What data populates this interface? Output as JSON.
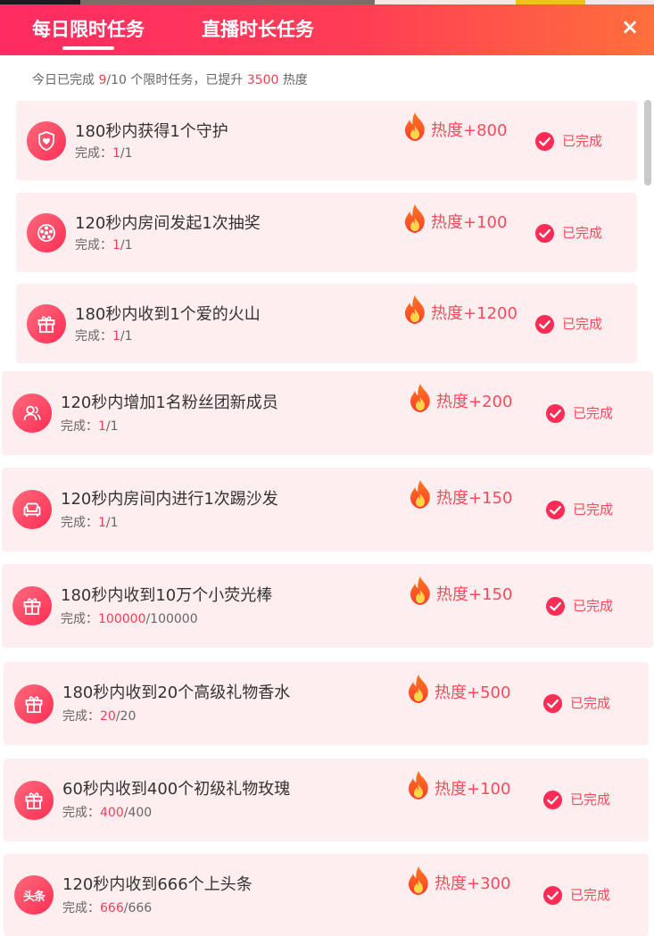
{
  "header": {
    "tabs": [
      {
        "label": "每日限时任务"
      },
      {
        "label": "直播时长任务"
      }
    ],
    "close_glyph": "×"
  },
  "summary": {
    "prefix": "今日已完成 ",
    "completed": "9",
    "total_part": "/10 个限时任务，已提升 ",
    "points": "3500",
    "suffix": " 热度"
  },
  "progress_prefix": "完成：",
  "tasks": [
    {
      "title": "180秒内获得1个守护",
      "progress_current": "1",
      "progress_total": "/1",
      "reward": "热度+800",
      "status": "已完成",
      "icon": "shield-heart-icon"
    },
    {
      "title": "120秒内房间发起1次抽奖",
      "progress_current": "1",
      "progress_total": "/1",
      "reward": "热度+100",
      "status": "已完成",
      "icon": "lottery-wheel-icon"
    },
    {
      "title": "180秒内收到1个爱的火山",
      "progress_current": "1",
      "progress_total": "/1",
      "reward": "热度+1200",
      "status": "已完成",
      "icon": "gift-icon"
    },
    {
      "title": "120秒内增加1名粉丝团新成员",
      "progress_current": "1",
      "progress_total": "/1",
      "reward": "热度+200",
      "status": "已完成",
      "icon": "fans-group-icon"
    },
    {
      "title": "120秒内房间内进行1次踢沙发",
      "progress_current": "1",
      "progress_total": "/1",
      "reward": "热度+150",
      "status": "已完成",
      "icon": "sofa-icon"
    },
    {
      "title": "180秒内收到10万个小荧光棒",
      "progress_current": "100000",
      "progress_total": "/100000",
      "reward": "热度+150",
      "status": "已完成",
      "icon": "gift-icon"
    },
    {
      "title": "180秒内收到20个高级礼物香水",
      "progress_current": "20",
      "progress_total": "/20",
      "reward": "热度+500",
      "status": "已完成",
      "icon": "gift-icon"
    },
    {
      "title": "60秒内收到400个初级礼物玫瑰",
      "progress_current": "400",
      "progress_total": "/400",
      "reward": "热度+100",
      "status": "已完成",
      "icon": "gift-icon"
    },
    {
      "title": "120秒内收到666个上头条",
      "progress_current": "666",
      "progress_total": "/666",
      "reward": "热度+300",
      "status": "已完成",
      "icon": "headline-icon",
      "icon_text": "头条"
    }
  ],
  "colors": {
    "header_start": "#ff2b63",
    "header_end": "#ff6f3c",
    "accent": "#ff3d55",
    "card_bg": "#ffeeef"
  }
}
